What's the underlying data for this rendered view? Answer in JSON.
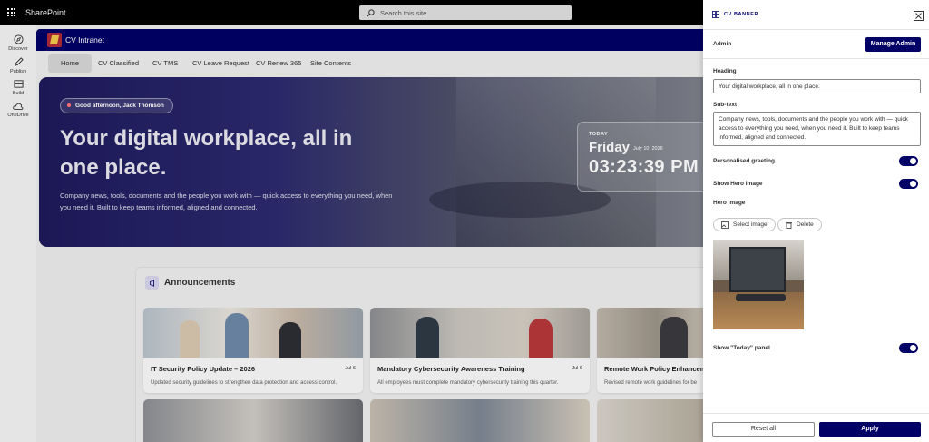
{
  "suite": {
    "app_name": "SharePoint",
    "search_placeholder": "Search this site"
  },
  "appbar": [
    {
      "label": "Discover",
      "icon": "compass-icon"
    },
    {
      "label": "Publish",
      "icon": "pen-icon"
    },
    {
      "label": "Build",
      "icon": "build-icon"
    },
    {
      "label": "OneDrive",
      "icon": "cloud-icon"
    }
  ],
  "site": {
    "name": "CV Intranet",
    "nav": [
      "Home",
      "CV Classified",
      "CV TMS",
      "CV Leave Request",
      "CV Renew 365",
      "Site Contents"
    ],
    "active_nav": "Home"
  },
  "hero": {
    "greeting": "Good afternoon, Jack Thomson",
    "heading": "Your digital workplace, all in one place.",
    "subtext": "Company news, tools, documents and the people you work with — quick access to everything you need, when you need it. Built to keep teams informed, aligned and connected.",
    "today_label": "TODAY",
    "today_day": "Friday",
    "today_date": "July 10, 2026",
    "today_time": "03:23:39 PM"
  },
  "announcements": {
    "title": "Announcements",
    "cards": [
      {
        "title": "IT Security Policy Update – 2026",
        "date": "Jul 6",
        "desc": "Updated security guidelines to strengthen data protection and access control."
      },
      {
        "title": "Mandatory Cybersecurity Awareness Training",
        "date": "Jul 6",
        "desc": "All employees must complete mandatory cybersecurity training this quarter."
      },
      {
        "title": "Remote Work Policy Enhancements",
        "date": "",
        "desc": "Revised remote work guidelines for be"
      }
    ]
  },
  "panel": {
    "title": "CV BANNER",
    "admin_label": "Admin",
    "manage_admin": "Manage Admin",
    "heading_label": "Heading",
    "heading_value": "Your digital workplace, all in one place.",
    "subtext_label": "Sub-text",
    "subtext_value": "Company news, tools, documents and the people you work with — quick access to everything you need, when you need it. Built to keep teams informed, aligned and connected.",
    "personalised_greeting": "Personalised greeting",
    "show_hero_image": "Show Hero Image",
    "hero_image_label": "Hero Image",
    "select_image": "Select image",
    "delete": "Delete",
    "show_today_panel": "Show \"Today\" panel",
    "reset_all": "Reset all",
    "apply": "Apply",
    "toggles": {
      "personalised_greeting": true,
      "show_hero_image": true,
      "show_today_panel": true
    }
  },
  "colors": {
    "brand": "#000066",
    "suitebar": "#000000"
  }
}
